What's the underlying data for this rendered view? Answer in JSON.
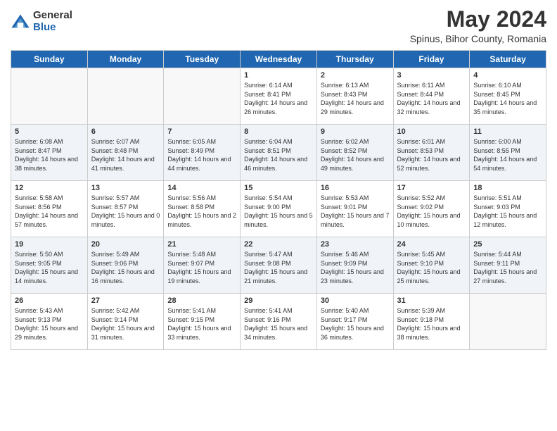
{
  "header": {
    "logo_general": "General",
    "logo_blue": "Blue",
    "main_title": "May 2024",
    "subtitle": "Spinus, Bihor County, Romania"
  },
  "days_of_week": [
    "Sunday",
    "Monday",
    "Tuesday",
    "Wednesday",
    "Thursday",
    "Friday",
    "Saturday"
  ],
  "weeks": [
    [
      {
        "day": "",
        "sunrise": "",
        "sunset": "",
        "daylight": ""
      },
      {
        "day": "",
        "sunrise": "",
        "sunset": "",
        "daylight": ""
      },
      {
        "day": "",
        "sunrise": "",
        "sunset": "",
        "daylight": ""
      },
      {
        "day": "1",
        "sunrise": "Sunrise: 6:14 AM",
        "sunset": "Sunset: 8:41 PM",
        "daylight": "Daylight: 14 hours and 26 minutes."
      },
      {
        "day": "2",
        "sunrise": "Sunrise: 6:13 AM",
        "sunset": "Sunset: 8:43 PM",
        "daylight": "Daylight: 14 hours and 29 minutes."
      },
      {
        "day": "3",
        "sunrise": "Sunrise: 6:11 AM",
        "sunset": "Sunset: 8:44 PM",
        "daylight": "Daylight: 14 hours and 32 minutes."
      },
      {
        "day": "4",
        "sunrise": "Sunrise: 6:10 AM",
        "sunset": "Sunset: 8:45 PM",
        "daylight": "Daylight: 14 hours and 35 minutes."
      }
    ],
    [
      {
        "day": "5",
        "sunrise": "Sunrise: 6:08 AM",
        "sunset": "Sunset: 8:47 PM",
        "daylight": "Daylight: 14 hours and 38 minutes."
      },
      {
        "day": "6",
        "sunrise": "Sunrise: 6:07 AM",
        "sunset": "Sunset: 8:48 PM",
        "daylight": "Daylight: 14 hours and 41 minutes."
      },
      {
        "day": "7",
        "sunrise": "Sunrise: 6:05 AM",
        "sunset": "Sunset: 8:49 PM",
        "daylight": "Daylight: 14 hours and 44 minutes."
      },
      {
        "day": "8",
        "sunrise": "Sunrise: 6:04 AM",
        "sunset": "Sunset: 8:51 PM",
        "daylight": "Daylight: 14 hours and 46 minutes."
      },
      {
        "day": "9",
        "sunrise": "Sunrise: 6:02 AM",
        "sunset": "Sunset: 8:52 PM",
        "daylight": "Daylight: 14 hours and 49 minutes."
      },
      {
        "day": "10",
        "sunrise": "Sunrise: 6:01 AM",
        "sunset": "Sunset: 8:53 PM",
        "daylight": "Daylight: 14 hours and 52 minutes."
      },
      {
        "day": "11",
        "sunrise": "Sunrise: 6:00 AM",
        "sunset": "Sunset: 8:55 PM",
        "daylight": "Daylight: 14 hours and 54 minutes."
      }
    ],
    [
      {
        "day": "12",
        "sunrise": "Sunrise: 5:58 AM",
        "sunset": "Sunset: 8:56 PM",
        "daylight": "Daylight: 14 hours and 57 minutes."
      },
      {
        "day": "13",
        "sunrise": "Sunrise: 5:57 AM",
        "sunset": "Sunset: 8:57 PM",
        "daylight": "Daylight: 15 hours and 0 minutes."
      },
      {
        "day": "14",
        "sunrise": "Sunrise: 5:56 AM",
        "sunset": "Sunset: 8:58 PM",
        "daylight": "Daylight: 15 hours and 2 minutes."
      },
      {
        "day": "15",
        "sunrise": "Sunrise: 5:54 AM",
        "sunset": "Sunset: 9:00 PM",
        "daylight": "Daylight: 15 hours and 5 minutes."
      },
      {
        "day": "16",
        "sunrise": "Sunrise: 5:53 AM",
        "sunset": "Sunset: 9:01 PM",
        "daylight": "Daylight: 15 hours and 7 minutes."
      },
      {
        "day": "17",
        "sunrise": "Sunrise: 5:52 AM",
        "sunset": "Sunset: 9:02 PM",
        "daylight": "Daylight: 15 hours and 10 minutes."
      },
      {
        "day": "18",
        "sunrise": "Sunrise: 5:51 AM",
        "sunset": "Sunset: 9:03 PM",
        "daylight": "Daylight: 15 hours and 12 minutes."
      }
    ],
    [
      {
        "day": "19",
        "sunrise": "Sunrise: 5:50 AM",
        "sunset": "Sunset: 9:05 PM",
        "daylight": "Daylight: 15 hours and 14 minutes."
      },
      {
        "day": "20",
        "sunrise": "Sunrise: 5:49 AM",
        "sunset": "Sunset: 9:06 PM",
        "daylight": "Daylight: 15 hours and 16 minutes."
      },
      {
        "day": "21",
        "sunrise": "Sunrise: 5:48 AM",
        "sunset": "Sunset: 9:07 PM",
        "daylight": "Daylight: 15 hours and 19 minutes."
      },
      {
        "day": "22",
        "sunrise": "Sunrise: 5:47 AM",
        "sunset": "Sunset: 9:08 PM",
        "daylight": "Daylight: 15 hours and 21 minutes."
      },
      {
        "day": "23",
        "sunrise": "Sunrise: 5:46 AM",
        "sunset": "Sunset: 9:09 PM",
        "daylight": "Daylight: 15 hours and 23 minutes."
      },
      {
        "day": "24",
        "sunrise": "Sunrise: 5:45 AM",
        "sunset": "Sunset: 9:10 PM",
        "daylight": "Daylight: 15 hours and 25 minutes."
      },
      {
        "day": "25",
        "sunrise": "Sunrise: 5:44 AM",
        "sunset": "Sunset: 9:11 PM",
        "daylight": "Daylight: 15 hours and 27 minutes."
      }
    ],
    [
      {
        "day": "26",
        "sunrise": "Sunrise: 5:43 AM",
        "sunset": "Sunset: 9:13 PM",
        "daylight": "Daylight: 15 hours and 29 minutes."
      },
      {
        "day": "27",
        "sunrise": "Sunrise: 5:42 AM",
        "sunset": "Sunset: 9:14 PM",
        "daylight": "Daylight: 15 hours and 31 minutes."
      },
      {
        "day": "28",
        "sunrise": "Sunrise: 5:41 AM",
        "sunset": "Sunset: 9:15 PM",
        "daylight": "Daylight: 15 hours and 33 minutes."
      },
      {
        "day": "29",
        "sunrise": "Sunrise: 5:41 AM",
        "sunset": "Sunset: 9:16 PM",
        "daylight": "Daylight: 15 hours and 34 minutes."
      },
      {
        "day": "30",
        "sunrise": "Sunrise: 5:40 AM",
        "sunset": "Sunset: 9:17 PM",
        "daylight": "Daylight: 15 hours and 36 minutes."
      },
      {
        "day": "31",
        "sunrise": "Sunrise: 5:39 AM",
        "sunset": "Sunset: 9:18 PM",
        "daylight": "Daylight: 15 hours and 38 minutes."
      },
      {
        "day": "",
        "sunrise": "",
        "sunset": "",
        "daylight": ""
      }
    ]
  ]
}
